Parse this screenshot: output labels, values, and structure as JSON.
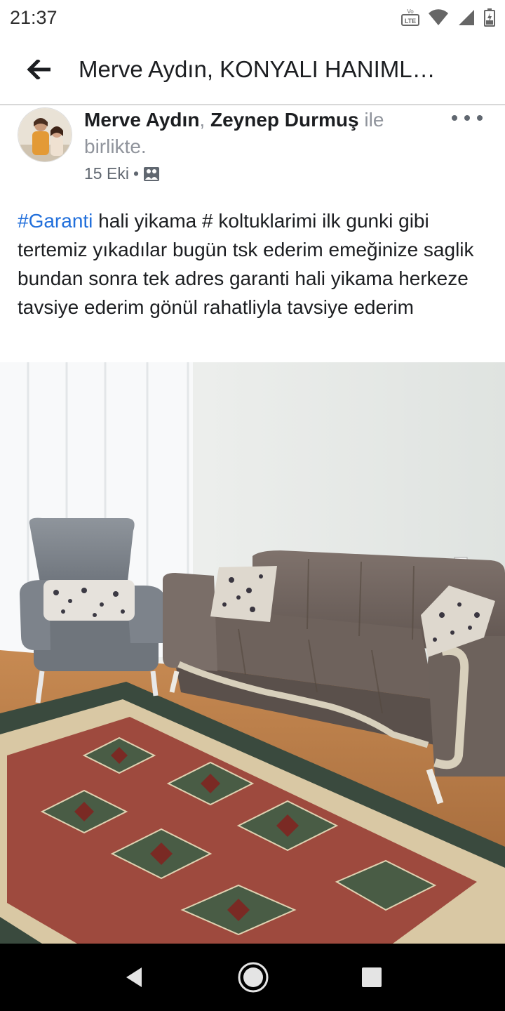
{
  "status_bar": {
    "time": "21:37",
    "icons": [
      "volte-lte-icon",
      "wifi-icon",
      "signal-icon",
      "battery-icon"
    ]
  },
  "app_bar": {
    "back_icon": "arrow-left-icon",
    "title": "Merve Aydın, KONYALI HANIML…"
  },
  "post": {
    "author": "Merve Aydın",
    "separator": ", ",
    "tagged": "Zeynep Durmuş",
    "with_text": " ile birlikte.",
    "date": "15 Eki",
    "dot": "•",
    "privacy_icon": "photo-album-icon",
    "hashtag": "#Garanti",
    "text": " hali yikama # koltuklarimi ilk gunki gibi tertemiz yıkadılar  bugün tsk ederim emeğinize saglik bundan sonra tek adres garanti hali yikama herkeze tavsiye ederim gönül rahatliyla tavsiye ederim"
  },
  "nav_bar": {
    "icons": [
      "back-triangle-icon",
      "home-circle-icon",
      "recents-square-icon"
    ]
  },
  "colors": {
    "link": "#216fdb",
    "text": "#1c1e21",
    "secondary": "#90949c",
    "nav_bg": "#000000"
  }
}
